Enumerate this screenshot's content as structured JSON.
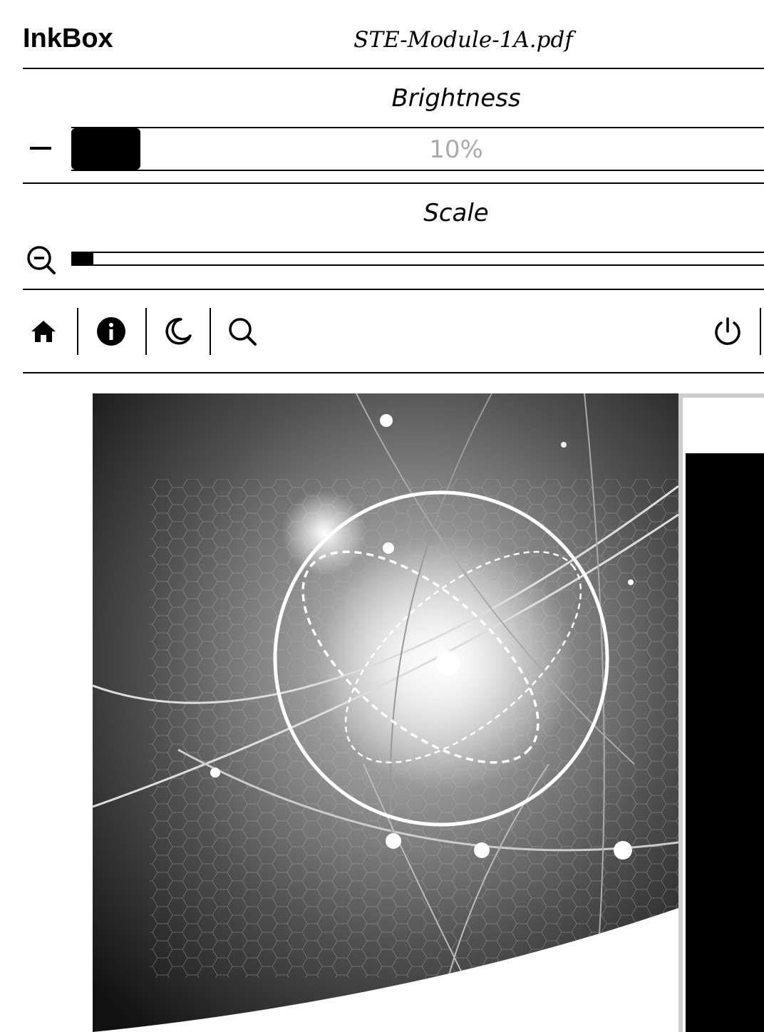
{
  "header": {
    "app_name": "InkBox",
    "document_title": "STE-Module-1A.pdf"
  },
  "brightness": {
    "label": "Brightness",
    "value_text": "10%",
    "level_fraction": 0.1
  },
  "scale": {
    "label": "Scale",
    "level_fraction": 0.03
  },
  "toolbar": {
    "icons": [
      "home-icon",
      "info-icon",
      "moon-icon",
      "search-icon",
      "power-icon"
    ]
  },
  "colors": {
    "foreground": "#000000",
    "background": "#ffffff",
    "disabled_text": "#aaaaaa"
  }
}
